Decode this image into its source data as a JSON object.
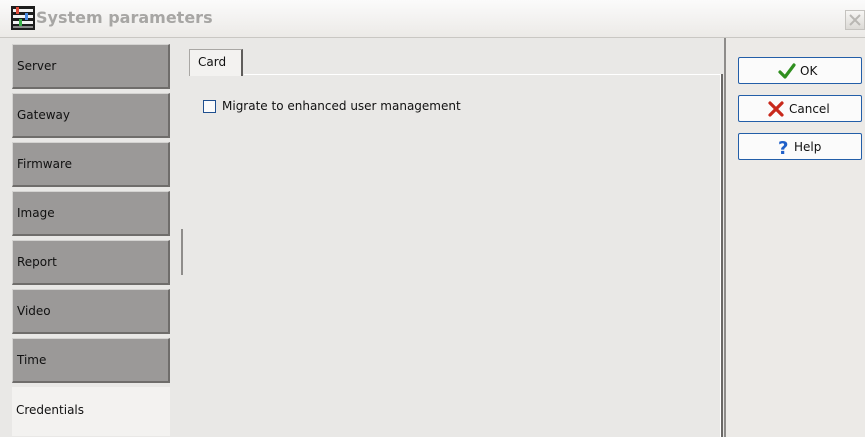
{
  "window": {
    "title": "System parameters",
    "icon": "app-parameters-icon",
    "close_icon": "close-icon"
  },
  "sidebar": {
    "items": [
      {
        "label": "Server"
      },
      {
        "label": "Gateway"
      },
      {
        "label": "Firmware"
      },
      {
        "label": "Image"
      },
      {
        "label": "Report"
      },
      {
        "label": "Video"
      },
      {
        "label": "Time"
      },
      {
        "label": "Credentials",
        "active": true
      }
    ]
  },
  "content": {
    "tabs": [
      {
        "label": "Card",
        "active": true
      }
    ],
    "checkbox": {
      "label": "Migrate to enhanced user management",
      "checked": false
    }
  },
  "actions": {
    "ok": {
      "label": "OK",
      "icon": "checkmark-icon",
      "color": "#2f8f1f"
    },
    "cancel": {
      "label": "Cancel",
      "icon": "x-icon",
      "color": "#c8281b"
    },
    "help": {
      "label": "Help",
      "icon": "question-icon",
      "color": "#1f5fc8"
    }
  },
  "colors": {
    "sidebar_inactive": "#9b9998",
    "sidebar_active": "#f3f2f0",
    "window_bg": "#e9e8e6",
    "button_border": "#235ea8"
  }
}
